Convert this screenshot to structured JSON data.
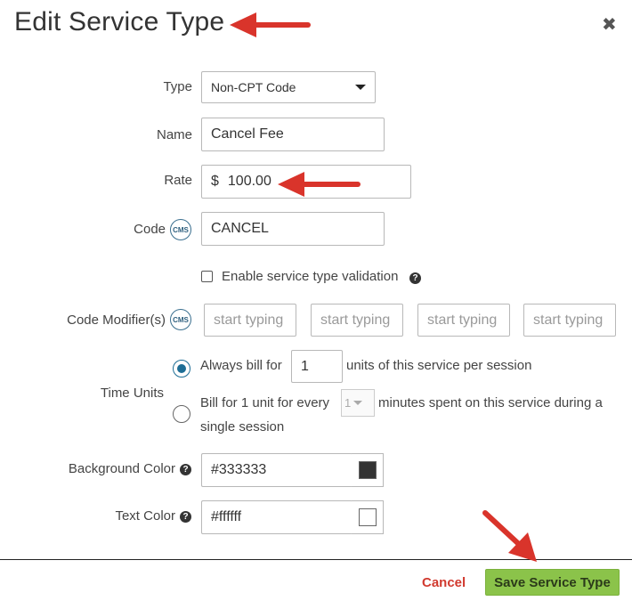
{
  "dialog": {
    "title": "Edit Service Type",
    "close_symbol": "✖"
  },
  "form": {
    "type": {
      "label": "Type",
      "value": "Non-CPT Code"
    },
    "name": {
      "label": "Name",
      "value": "Cancel Fee"
    },
    "rate": {
      "label": "Rate",
      "currency": "$",
      "value": "100.00"
    },
    "code": {
      "label": "Code",
      "badge": "CMS",
      "value": "CANCEL"
    },
    "validation": {
      "label": "Enable service type validation",
      "checked": false,
      "help_symbol": "?"
    },
    "code_modifiers": {
      "label": "Code Modifier(s)",
      "badge": "CMS",
      "placeholders": [
        "start typing",
        "start typing",
        "start typing",
        "start typing"
      ]
    },
    "time_units": {
      "label": "Time Units",
      "option1": {
        "prefix": "Always bill for",
        "value": "1",
        "suffix": "units of this service per session",
        "selected": true
      },
      "option2": {
        "prefix": "Bill for 1 unit for every",
        "value": "1",
        "suffix_line1": "minutes spent on this service during a",
        "suffix_line2": "single session",
        "selected": false
      }
    },
    "background_color": {
      "label": "Background Color",
      "value": "#333333",
      "swatch": "#333333",
      "help_symbol": "?"
    },
    "text_color": {
      "label": "Text Color",
      "value": "#ffffff",
      "swatch": "#ffffff",
      "help_symbol": "?"
    }
  },
  "footer": {
    "cancel_label": "Cancel",
    "save_label": "Save Service Type"
  },
  "colors": {
    "accent_save": "#8bc34a",
    "cancel_text": "#d13a2f",
    "annotation_arrow": "#d9342b",
    "radio_selected": "#1d6d95"
  }
}
